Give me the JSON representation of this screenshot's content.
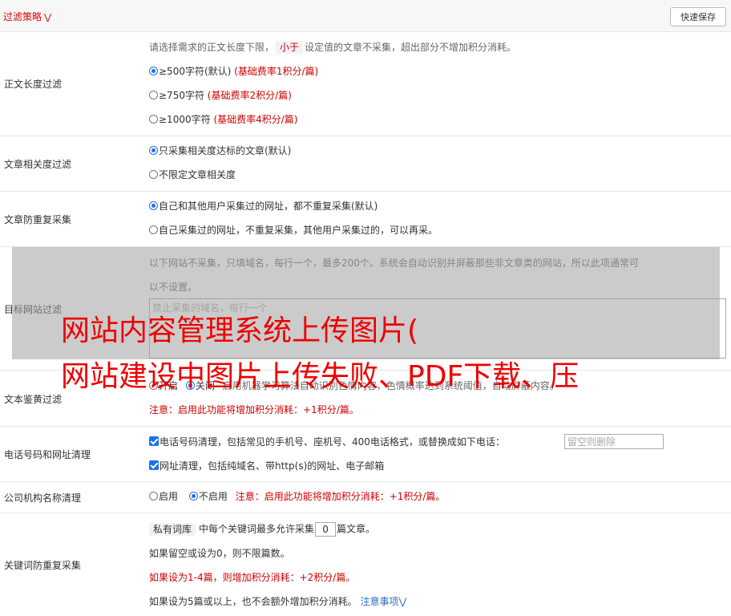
{
  "header": {
    "title": "过滤策略",
    "chevron_icon": "chevron-down-icon",
    "save_label": "快速保存"
  },
  "length_filter": {
    "label": "正文长度过滤",
    "description_pre": "请选择需求的正文长度下限，",
    "description_tag": "小于",
    "description_post": "设定值的文章不采集，超出部分不增加积分消耗。",
    "options": [
      {
        "label": "≥500字符(默认)",
        "note": "(基础费率1积分/篇)",
        "selected": true
      },
      {
        "label": "≥750字符",
        "note": "(基础费率2积分/篇)",
        "selected": false
      },
      {
        "label": "≥1000字符",
        "note": "(基础费率4积分/篇)",
        "selected": false
      }
    ]
  },
  "relevance_filter": {
    "label": "文章相关度过滤",
    "options": [
      {
        "label": "只采集相关度达标的文章(默认)",
        "selected": true
      },
      {
        "label": "不限定文章相关度",
        "selected": false
      }
    ]
  },
  "dedupe": {
    "label": "文章防重复采集",
    "options": [
      {
        "label": "自己和其他用户采集过的网址，都不重复采集(默认)",
        "selected": true
      },
      {
        "label": "自己采集过的网址，不重复采集，其他用户采集过的，可以再采。",
        "selected": false
      }
    ]
  },
  "site_filter": {
    "label": "目标网站过滤",
    "desc_line1": "以下网站不采集，只填域名，每行一个，最多200个。系统会自动识别并屏蔽那些非文章类的网站，所以此项通常可",
    "desc_line2": "以不设置。",
    "placeholder": "禁止采集的域名，每行一个"
  },
  "porn_filter": {
    "label": "文本鉴黄过滤",
    "enable_label": "开启",
    "disable_label": "关闭",
    "desc": "启用机器学习算法自动识别色情内容，色情概率达到系统阈值，自动屏蔽内容。",
    "notice": "注意：启用此功能将增加积分消耗：+1积分/篇。",
    "enabled": false
  },
  "phone_url": {
    "label": "电话号码和网址清理",
    "phone_label": "电话号码清理，包括常见的手机号、座机号、400电话格式，或替换成如下电话：",
    "phone_placeholder": "留空则删除",
    "url_label": "网址清理，包括纯域名、带http(s)的网址、电子邮箱",
    "phone_checked": true,
    "url_checked": true
  },
  "company": {
    "label": "公司机构名称清理",
    "enable_label": "启用",
    "disable_label": "不启用",
    "notice": "注意：启用此功能将增加积分消耗：+1积分/篇。",
    "enabled": false
  },
  "keyword": {
    "label": "关键词防重复采集",
    "tag": "私有词库",
    "line1_pre": "中每个关键词最多允许采集",
    "count": "0",
    "line1_post": "篇文章。",
    "line2": "如果留空或设为0，则不限篇数。",
    "line3": "如果设为1-4篇，则增加积分消耗：+2积分/篇。",
    "line4": "如果设为5篇或以上，也不会额外增加积分消耗。",
    "notes_link": "注意事项"
  },
  "overlay": {
    "line1": "网站内容管理系统上传图片(",
    "line2": "网站建设中图片上传失败、PDF下载、压"
  },
  "colors": {
    "accent": "#e00000",
    "notice": "#cc0000",
    "link": "#2b6cc4",
    "control": "#1a73e8"
  }
}
